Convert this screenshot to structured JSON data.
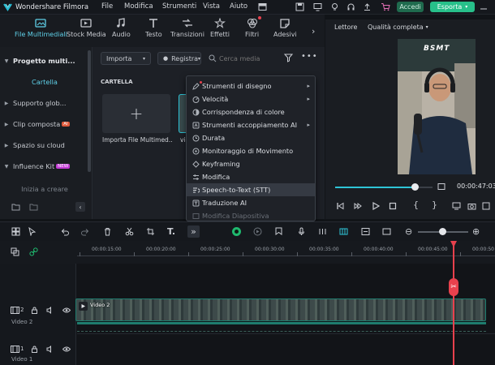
{
  "titlebar": {
    "app_name": "Wondershare Filmora",
    "menus": [
      "File",
      "Modifica",
      "Strumenti",
      "Vista",
      "Aiuto"
    ],
    "login_label": "Accedi",
    "export_label": "Esporta"
  },
  "toolbar": {
    "tools": [
      {
        "label": "File Multimediali",
        "icon": "media-icon"
      },
      {
        "label": "Stock Media",
        "icon": "stock-media-icon"
      },
      {
        "label": "Audio",
        "icon": "music-note-icon"
      },
      {
        "label": "Testo",
        "icon": "text-icon"
      },
      {
        "label": "Transizioni",
        "icon": "transition-icon"
      },
      {
        "label": "Effetti",
        "icon": "effects-icon"
      },
      {
        "label": "Filtri",
        "icon": "filters-icon"
      },
      {
        "label": "Adesivi",
        "icon": "stickers-icon"
      }
    ]
  },
  "sidebar": {
    "items": [
      {
        "label": "Progetto multi...",
        "bold": true
      },
      {
        "label": "Cartella"
      },
      {
        "label": "Supporto glob..."
      },
      {
        "label": "Clip composta",
        "badge": "AI"
      },
      {
        "label": "Spazio su cloud"
      },
      {
        "label": "Influence Kit",
        "badge": "NEW"
      },
      {
        "label": "Inizia a creare"
      }
    ]
  },
  "media": {
    "import_label": "Importa",
    "record_label": "Registra",
    "search_placeholder": "Cerca media",
    "folder_label": "CARTELLA",
    "import_tile_label": "Importa File Multimed...",
    "clip_tile_label": "vid"
  },
  "context_menu": {
    "items": [
      {
        "label": "Strumenti di disegno",
        "submenu": true
      },
      {
        "label": "Velocità",
        "submenu": true
      },
      {
        "label": "Corrispondenza di colore",
        "submenu": false
      },
      {
        "label": "Strumenti accoppiamento AI",
        "submenu": true
      },
      {
        "label": "Durata",
        "submenu": false
      },
      {
        "label": "Monitoraggio di Movimento",
        "submenu": false
      },
      {
        "label": "Keyframing",
        "submenu": false
      },
      {
        "label": "Modifica",
        "submenu": false
      },
      {
        "label": "Speech-to-Text (STT)",
        "submenu": false,
        "highlighted": true
      },
      {
        "label": "Traduzione AI",
        "submenu": false
      },
      {
        "label": "Modifica Diapositiva",
        "submenu": false,
        "disabled": true
      }
    ]
  },
  "player": {
    "tab_player": "Lettore",
    "quality_label": "Qualità completa",
    "timecode": "00:00:47:03",
    "progress": 0.82,
    "video_overlay_text": "BSMT"
  },
  "timeline": {
    "ticks": [
      "00:00:15:00",
      "00:00:20:00",
      "00:00:25:00",
      "00:00:30:00",
      "00:00:35:00",
      "00:00:40:00",
      "00:00:45:00",
      "00:00:50"
    ],
    "tracks": [
      {
        "number": "2",
        "name": "Video 2"
      },
      {
        "number": "1",
        "name": "Video 1"
      }
    ],
    "clip_label": "Video 2"
  },
  "colors": {
    "accent_teal": "#2ec4d6",
    "login_green": "#1f6b4e",
    "export_green": "#27c08a",
    "playhead_red": "#e8414d"
  }
}
